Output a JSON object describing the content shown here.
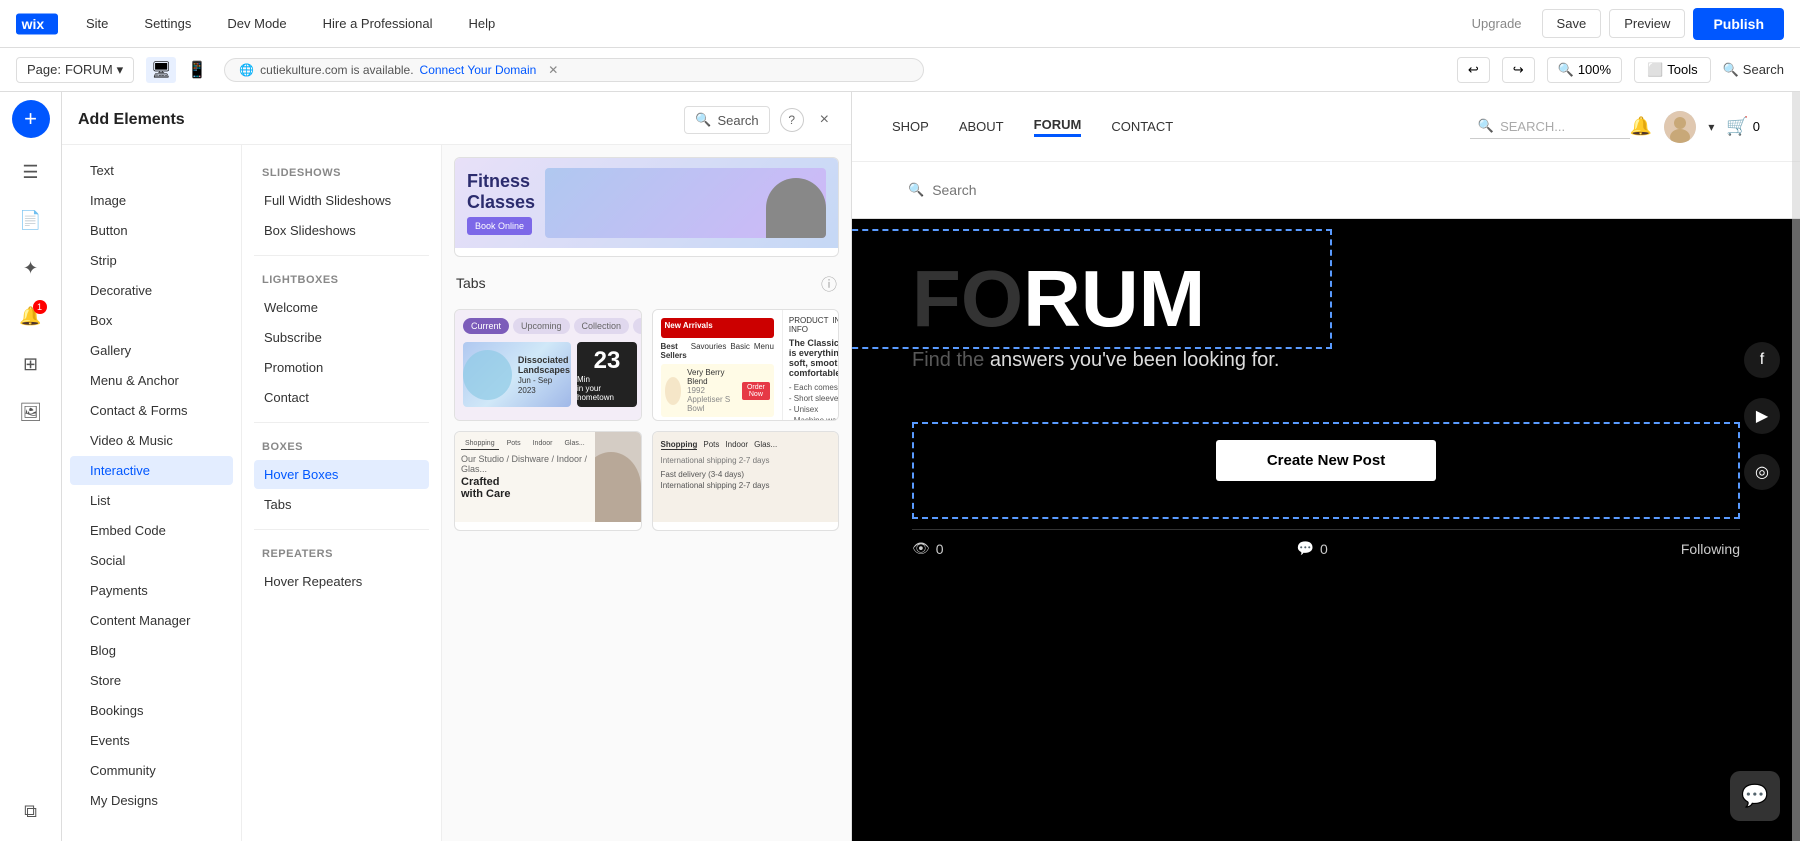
{
  "topbar": {
    "logo": "Wix",
    "nav": [
      "Site",
      "Settings",
      "Dev Mode",
      "Hire a Professional",
      "Help"
    ],
    "upgrade_label": "Upgrade",
    "save_label": "Save",
    "preview_label": "Preview",
    "publish_label": "Publish"
  },
  "secondbar": {
    "page_label": "Page:",
    "page_name": "FORUM",
    "zoom_level": "100%",
    "tools_label": "Tools",
    "search_label": "Search",
    "domain_text": "cutiekulture.com is available.",
    "connect_label": "Connect Your Domain"
  },
  "add_elements_panel": {
    "title": "Add Elements",
    "search_label": "Search",
    "close_label": "×",
    "categories": [
      "Text",
      "Image",
      "Button",
      "Strip",
      "Decorative",
      "Box",
      "Gallery",
      "Menu & Anchor",
      "Contact & Forms",
      "Video & Music",
      "Interactive",
      "List",
      "Embed Code",
      "Social",
      "Payments",
      "Content Manager",
      "Blog",
      "Store",
      "Bookings",
      "Events",
      "Community",
      "My Designs"
    ],
    "active_category": "Interactive",
    "subcategories": {
      "slideshows_title": "SLIDESHOWS",
      "slideshows": [
        "Full Width Slideshows",
        "Box Slideshows"
      ],
      "lightboxes_title": "LIGHTBOXES",
      "lightboxes": [
        "Welcome",
        "Subscribe",
        "Promotion",
        "Contact"
      ],
      "boxes_title": "BOXES",
      "boxes": [
        "Hover Boxes",
        "Tabs"
      ],
      "repeaters_title": "REPEATERS",
      "repeaters": [
        "Hover Repeaters"
      ],
      "active_box": "Hover Boxes"
    },
    "content_section": {
      "tabs_label": "Tabs",
      "widgets": [
        {
          "id": "fitness",
          "type": "fitness-banner"
        },
        {
          "id": "tabs",
          "type": "tabs-widget"
        },
        {
          "id": "repeater",
          "type": "repeater-widget"
        },
        {
          "id": "crafted",
          "type": "crafted-widget"
        }
      ]
    }
  },
  "website": {
    "nav": {
      "links": [
        "SHOP",
        "ABOUT",
        "FORUM",
        "CONTACT"
      ],
      "active": "FORUM",
      "search_placeholder": "SEARCH...",
      "cart_count": "0"
    },
    "forum": {
      "heading": "RUM",
      "subtext": "answers you've been looking for.",
      "search_placeholder": "Search",
      "create_post_label": "Create New Post",
      "stats": {
        "views": "0",
        "comments": "0",
        "following_label": "Following"
      }
    },
    "social_icons": [
      "f",
      "▶",
      "◎"
    ]
  }
}
